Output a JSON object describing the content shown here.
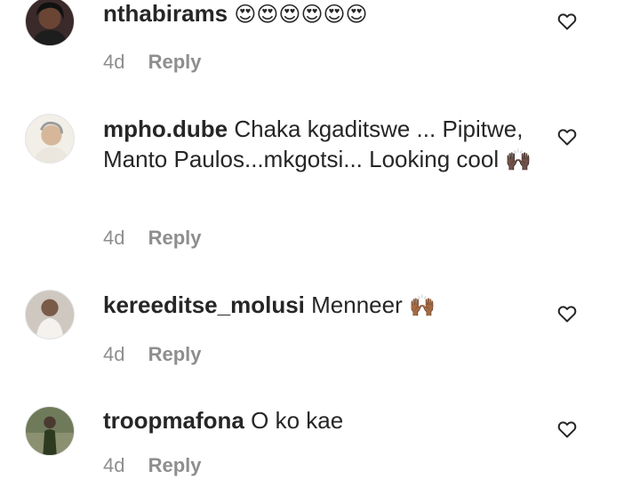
{
  "comments": [
    {
      "username": "nthabirams",
      "text": "",
      "emoji": "😍😍😍😍😍😍",
      "time": "4d",
      "reply_label": "Reply"
    },
    {
      "username": "mpho.dube",
      "text": "Chaka kgaditswe ... Pipitwe, Manto Paulos...mkgotsi... Looking cool",
      "emoji": "🙌🏿",
      "time": "4d",
      "reply_label": "Reply"
    },
    {
      "username": "kereeditse_molusi",
      "text": "Menneer",
      "emoji": "🙌🏾",
      "time": "4d",
      "reply_label": "Reply"
    },
    {
      "username": "troopmafona",
      "text": "O ko kae",
      "emoji": "",
      "time": "4d",
      "reply_label": "Reply"
    }
  ],
  "icons": {
    "like": "heart-outline-icon"
  },
  "colors": {
    "text": "#262626",
    "meta": "#8e8e8e",
    "background": "#ffffff"
  }
}
